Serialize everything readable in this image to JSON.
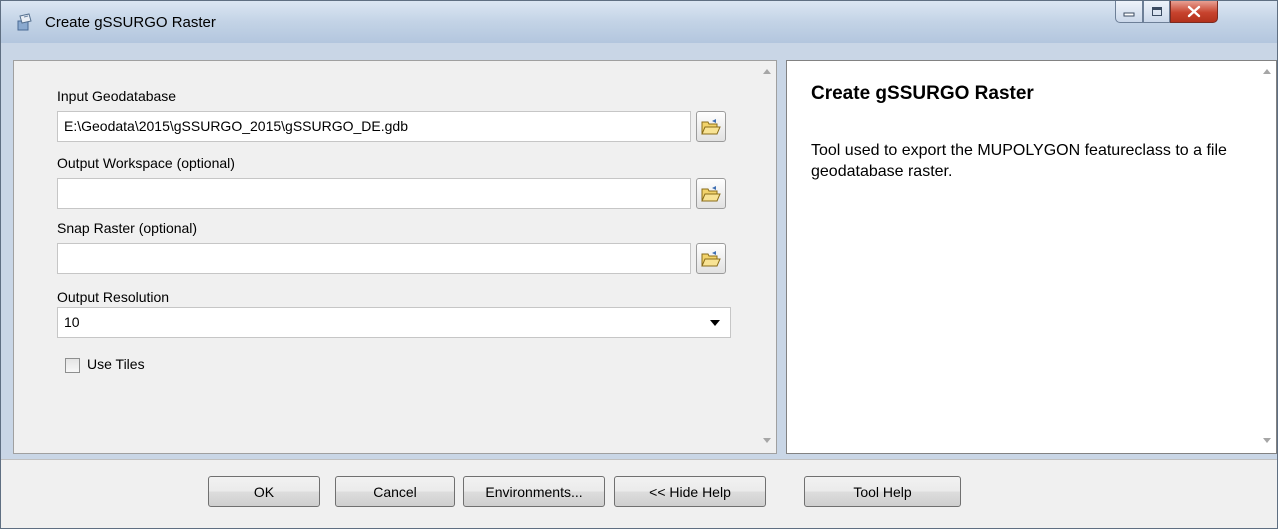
{
  "window": {
    "title": "Create gSSURGO Raster"
  },
  "params": {
    "input_geodatabase": {
      "label": "Input Geodatabase",
      "value": "E:\\Geodata\\2015\\gSSURGO_2015\\gSSURGO_DE.gdb"
    },
    "output_workspace": {
      "label": "Output Workspace (optional)",
      "value": ""
    },
    "snap_raster": {
      "label": "Snap Raster (optional)",
      "value": ""
    },
    "output_resolution": {
      "label": "Output Resolution",
      "value": "10"
    },
    "use_tiles": {
      "label": "Use Tiles",
      "checked": false
    }
  },
  "help": {
    "title": "Create gSSURGO Raster",
    "body": "Tool used to export the MUPOLYGON featureclass to a file geodatabase raster."
  },
  "buttons": {
    "ok": "OK",
    "cancel": "Cancel",
    "environments": "Environments...",
    "hide_help": "<< Hide Help",
    "tool_help": "Tool Help"
  },
  "icons": {
    "app": "tool-icon",
    "browse": "folder-open-icon",
    "minimize": "minimize-icon",
    "maximize": "maximize-icon",
    "close": "close-icon"
  }
}
